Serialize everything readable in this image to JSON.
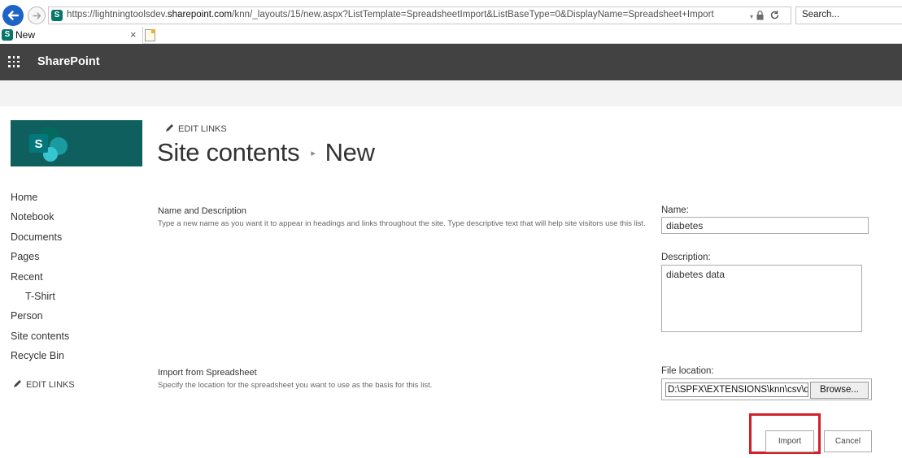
{
  "browser": {
    "url_prefix": "https://lightningtoolsdev.",
    "url_host": "sharepoint.com",
    "url_rest": "/knn/_layouts/15/new.aspx?ListTemplate=SpreadsheetImport&ListBaseType=0&DisplayName=Spreadsheet+Import",
    "search_placeholder": "Search...",
    "tab_title": "New",
    "tab_close": "×"
  },
  "suite": {
    "brand": "SharePoint"
  },
  "header": {
    "edit_links": "EDIT LINKS",
    "breadcrumb_parent": "Site contents",
    "breadcrumb_sep": "▸",
    "breadcrumb_current": "New"
  },
  "nav": {
    "items": [
      {
        "label": "Home",
        "sub": false
      },
      {
        "label": "Notebook",
        "sub": false
      },
      {
        "label": "Documents",
        "sub": false
      },
      {
        "label": "Pages",
        "sub": false
      },
      {
        "label": "Recent",
        "sub": false
      },
      {
        "label": "T-Shirt",
        "sub": true
      },
      {
        "label": "Person",
        "sub": false
      },
      {
        "label": "Site contents",
        "sub": false
      },
      {
        "label": "Recycle Bin",
        "sub": false
      }
    ],
    "edit_links": "EDIT LINKS"
  },
  "form": {
    "name_section": {
      "title": "Name and Description",
      "description": "Type a new name as you want it to appear in headings and links throughout the site. Type descriptive text that will help site visitors use this list."
    },
    "name_label": "Name:",
    "name_value": "diabetes",
    "description_label": "Description:",
    "description_value": "diabetes data",
    "import_section": {
      "title": "Import from Spreadsheet",
      "description": "Specify the location for the spreadsheet you want to use as the basis for this list."
    },
    "file_label": "File location:",
    "file_value": "D:\\SPFX\\EXTENSIONS\\knn\\csv\\diabetes.csv",
    "browse_label": "Browse...",
    "import_label": "Import",
    "cancel_label": "Cancel"
  },
  "colors": {
    "suite_bar": "#424242",
    "site_logo_bg": "#0f5f5f",
    "sharepoint_teal": "#077568",
    "highlight": "#d21f2a"
  },
  "icons": [
    "back-arrow-icon",
    "forward-arrow-icon",
    "sharepoint-favicon-icon",
    "lock-icon",
    "reload-icon",
    "new-tab-icon",
    "waffle-icon",
    "sharepoint-logo-icon",
    "pencil-icon"
  ]
}
